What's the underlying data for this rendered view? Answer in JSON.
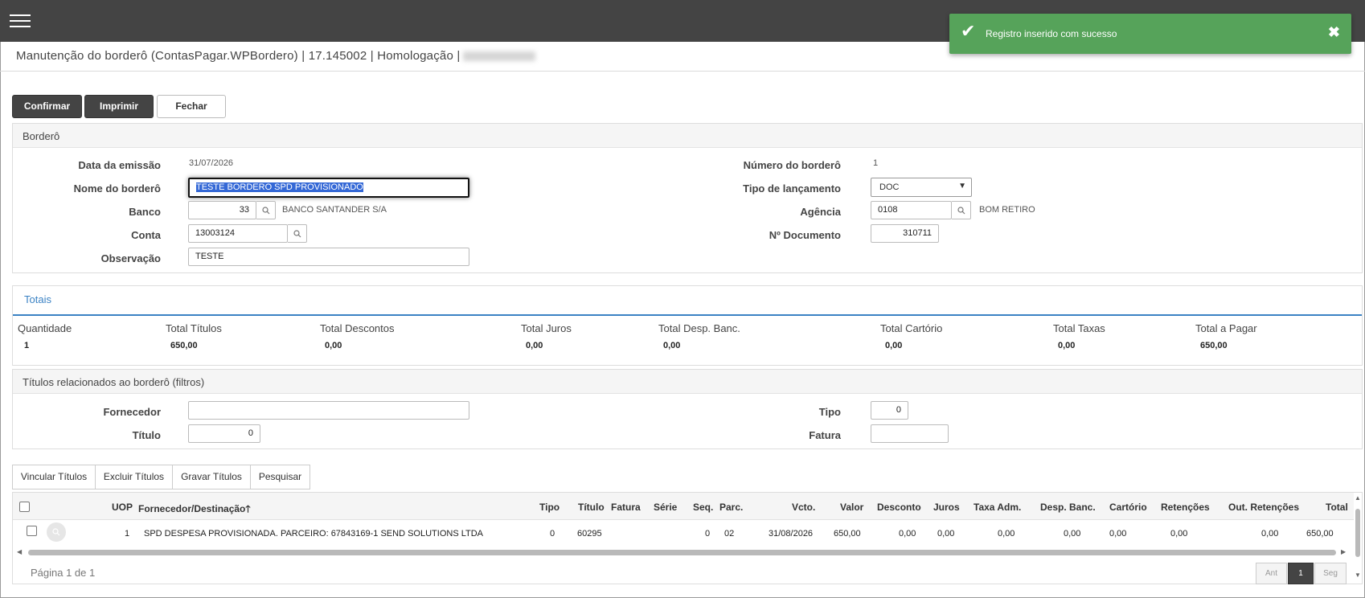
{
  "header": {
    "title": "Manutenção do borderô (ContasPagar.WPBordero) | 17.145002 | Homologação |"
  },
  "toast": {
    "message": "Registro inserido com sucesso",
    "close": "✖",
    "color": "#56a35a"
  },
  "toolbar": {
    "confirm": "Confirmar",
    "print": "Imprimir",
    "close": "Fechar"
  },
  "bordero": {
    "section_title": "Borderô",
    "data_emissao_label": "Data da emissão",
    "data_emissao": "31/07/2026",
    "nome_label": "Nome do borderô",
    "nome": "TESTE BORDERO SPD PROVISIONADO",
    "banco_label": "Banco",
    "banco": "33",
    "banco_nome": "BANCO SANTANDER S/A",
    "conta_label": "Conta",
    "conta": "13003124",
    "observacao_label": "Observação",
    "observacao": "TESTE",
    "numero_label": "Número do borderô",
    "numero": "1",
    "tipo_lancamento_label": "Tipo de lançamento",
    "tipo_lancamento": "DOC",
    "agencia_label": "Agência",
    "agencia": "0108",
    "agencia_nome": "BOM RETIRO",
    "documento_label": "Nº Documento",
    "documento": "310711"
  },
  "totais": {
    "tab": "Totais",
    "items": [
      {
        "label": "Quantidade",
        "value": "1"
      },
      {
        "label": "Total Títulos",
        "value": "650,00"
      },
      {
        "label": "Total Descontos",
        "value": "0,00"
      },
      {
        "label": "Total Juros",
        "value": "0,00"
      },
      {
        "label": "Total Desp. Banc.",
        "value": "0,00"
      },
      {
        "label": "Total Cartório",
        "value": "0,00"
      },
      {
        "label": "Total Taxas",
        "value": "0,00"
      },
      {
        "label": "Total a Pagar",
        "value": "650,00"
      }
    ]
  },
  "filtros": {
    "section_title": "Títulos relacionados ao borderô (filtros)",
    "fornecedor_label": "Fornecedor",
    "fornecedor": "",
    "titulo_label": "Título",
    "titulo": "0",
    "tipo_label": "Tipo",
    "tipo": "0",
    "fatura_label": "Fatura",
    "fatura": ""
  },
  "grid_buttons": {
    "vincular": "Vincular Títulos",
    "excluir": "Excluir Títulos",
    "gravar": "Gravar Títulos",
    "pesquisar": "Pesquisar"
  },
  "grid": {
    "columns": {
      "uop": "UOP",
      "fornecedor": "Fornecedor/Destinação",
      "sort_indicator": "🡑",
      "tipo": "Tipo",
      "titulo": "Título",
      "fatura": "Fatura",
      "serie": "Série",
      "seq": "Seq.",
      "parc": "Parc.",
      "vcto": "Vcto.",
      "valor": "Valor",
      "desconto": "Desconto",
      "juros": "Juros",
      "taxa_adm": "Taxa Adm.",
      "desp_banc": "Desp. Banc.",
      "cartorio": "Cartório",
      "retencoes": "Retenções",
      "out_retencoes": "Out. Retenções",
      "total": "Total"
    },
    "rows": [
      {
        "uop": "1",
        "fornecedor": "SPD DESPESA PROVISIONADA. PARCEIRO: 67843169-1 SEND SOLUTIONS LTDA",
        "tipo": "0",
        "titulo": "60295",
        "fatura": "",
        "serie": "",
        "seq": "0",
        "parc": "02",
        "vcto": "31/08/2026",
        "valor": "650,00",
        "desconto": "0,00",
        "juros": "0,00",
        "taxa_adm": "0,00",
        "desp_banc": "0,00",
        "cartorio": "0,00",
        "retencoes": "0,00",
        "out_retencoes": "0,00",
        "total": "650,00"
      }
    ],
    "pager": {
      "text": "Página 1 de 1",
      "prev": "Ant",
      "current": "1",
      "next": "Seg"
    }
  }
}
